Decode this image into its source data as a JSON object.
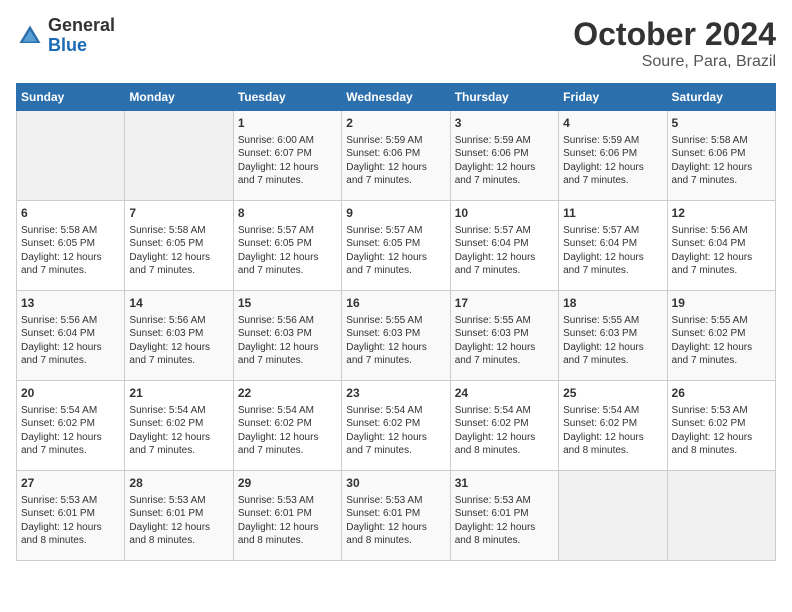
{
  "header": {
    "logo": {
      "general": "General",
      "blue": "Blue"
    },
    "title": "October 2024",
    "subtitle": "Soure, Para, Brazil"
  },
  "weekdays": [
    "Sunday",
    "Monday",
    "Tuesday",
    "Wednesday",
    "Thursday",
    "Friday",
    "Saturday"
  ],
  "weeks": [
    [
      {
        "day": "",
        "empty": true
      },
      {
        "day": "",
        "empty": true
      },
      {
        "day": "1",
        "sunrise": "Sunrise: 6:00 AM",
        "sunset": "Sunset: 6:07 PM",
        "daylight": "Daylight: 12 hours and 7 minutes."
      },
      {
        "day": "2",
        "sunrise": "Sunrise: 5:59 AM",
        "sunset": "Sunset: 6:06 PM",
        "daylight": "Daylight: 12 hours and 7 minutes."
      },
      {
        "day": "3",
        "sunrise": "Sunrise: 5:59 AM",
        "sunset": "Sunset: 6:06 PM",
        "daylight": "Daylight: 12 hours and 7 minutes."
      },
      {
        "day": "4",
        "sunrise": "Sunrise: 5:59 AM",
        "sunset": "Sunset: 6:06 PM",
        "daylight": "Daylight: 12 hours and 7 minutes."
      },
      {
        "day": "5",
        "sunrise": "Sunrise: 5:58 AM",
        "sunset": "Sunset: 6:06 PM",
        "daylight": "Daylight: 12 hours and 7 minutes."
      }
    ],
    [
      {
        "day": "6",
        "sunrise": "Sunrise: 5:58 AM",
        "sunset": "Sunset: 6:05 PM",
        "daylight": "Daylight: 12 hours and 7 minutes."
      },
      {
        "day": "7",
        "sunrise": "Sunrise: 5:58 AM",
        "sunset": "Sunset: 6:05 PM",
        "daylight": "Daylight: 12 hours and 7 minutes."
      },
      {
        "day": "8",
        "sunrise": "Sunrise: 5:57 AM",
        "sunset": "Sunset: 6:05 PM",
        "daylight": "Daylight: 12 hours and 7 minutes."
      },
      {
        "day": "9",
        "sunrise": "Sunrise: 5:57 AM",
        "sunset": "Sunset: 6:05 PM",
        "daylight": "Daylight: 12 hours and 7 minutes."
      },
      {
        "day": "10",
        "sunrise": "Sunrise: 5:57 AM",
        "sunset": "Sunset: 6:04 PM",
        "daylight": "Daylight: 12 hours and 7 minutes."
      },
      {
        "day": "11",
        "sunrise": "Sunrise: 5:57 AM",
        "sunset": "Sunset: 6:04 PM",
        "daylight": "Daylight: 12 hours and 7 minutes."
      },
      {
        "day": "12",
        "sunrise": "Sunrise: 5:56 AM",
        "sunset": "Sunset: 6:04 PM",
        "daylight": "Daylight: 12 hours and 7 minutes."
      }
    ],
    [
      {
        "day": "13",
        "sunrise": "Sunrise: 5:56 AM",
        "sunset": "Sunset: 6:04 PM",
        "daylight": "Daylight: 12 hours and 7 minutes."
      },
      {
        "day": "14",
        "sunrise": "Sunrise: 5:56 AM",
        "sunset": "Sunset: 6:03 PM",
        "daylight": "Daylight: 12 hours and 7 minutes."
      },
      {
        "day": "15",
        "sunrise": "Sunrise: 5:56 AM",
        "sunset": "Sunset: 6:03 PM",
        "daylight": "Daylight: 12 hours and 7 minutes."
      },
      {
        "day": "16",
        "sunrise": "Sunrise: 5:55 AM",
        "sunset": "Sunset: 6:03 PM",
        "daylight": "Daylight: 12 hours and 7 minutes."
      },
      {
        "day": "17",
        "sunrise": "Sunrise: 5:55 AM",
        "sunset": "Sunset: 6:03 PM",
        "daylight": "Daylight: 12 hours and 7 minutes."
      },
      {
        "day": "18",
        "sunrise": "Sunrise: 5:55 AM",
        "sunset": "Sunset: 6:03 PM",
        "daylight": "Daylight: 12 hours and 7 minutes."
      },
      {
        "day": "19",
        "sunrise": "Sunrise: 5:55 AM",
        "sunset": "Sunset: 6:02 PM",
        "daylight": "Daylight: 12 hours and 7 minutes."
      }
    ],
    [
      {
        "day": "20",
        "sunrise": "Sunrise: 5:54 AM",
        "sunset": "Sunset: 6:02 PM",
        "daylight": "Daylight: 12 hours and 7 minutes."
      },
      {
        "day": "21",
        "sunrise": "Sunrise: 5:54 AM",
        "sunset": "Sunset: 6:02 PM",
        "daylight": "Daylight: 12 hours and 7 minutes."
      },
      {
        "day": "22",
        "sunrise": "Sunrise: 5:54 AM",
        "sunset": "Sunset: 6:02 PM",
        "daylight": "Daylight: 12 hours and 7 minutes."
      },
      {
        "day": "23",
        "sunrise": "Sunrise: 5:54 AM",
        "sunset": "Sunset: 6:02 PM",
        "daylight": "Daylight: 12 hours and 7 minutes."
      },
      {
        "day": "24",
        "sunrise": "Sunrise: 5:54 AM",
        "sunset": "Sunset: 6:02 PM",
        "daylight": "Daylight: 12 hours and 8 minutes."
      },
      {
        "day": "25",
        "sunrise": "Sunrise: 5:54 AM",
        "sunset": "Sunset: 6:02 PM",
        "daylight": "Daylight: 12 hours and 8 minutes."
      },
      {
        "day": "26",
        "sunrise": "Sunrise: 5:53 AM",
        "sunset": "Sunset: 6:02 PM",
        "daylight": "Daylight: 12 hours and 8 minutes."
      }
    ],
    [
      {
        "day": "27",
        "sunrise": "Sunrise: 5:53 AM",
        "sunset": "Sunset: 6:01 PM",
        "daylight": "Daylight: 12 hours and 8 minutes."
      },
      {
        "day": "28",
        "sunrise": "Sunrise: 5:53 AM",
        "sunset": "Sunset: 6:01 PM",
        "daylight": "Daylight: 12 hours and 8 minutes."
      },
      {
        "day": "29",
        "sunrise": "Sunrise: 5:53 AM",
        "sunset": "Sunset: 6:01 PM",
        "daylight": "Daylight: 12 hours and 8 minutes."
      },
      {
        "day": "30",
        "sunrise": "Sunrise: 5:53 AM",
        "sunset": "Sunset: 6:01 PM",
        "daylight": "Daylight: 12 hours and 8 minutes."
      },
      {
        "day": "31",
        "sunrise": "Sunrise: 5:53 AM",
        "sunset": "Sunset: 6:01 PM",
        "daylight": "Daylight: 12 hours and 8 minutes."
      },
      {
        "day": "",
        "empty": true
      },
      {
        "day": "",
        "empty": true
      }
    ]
  ]
}
